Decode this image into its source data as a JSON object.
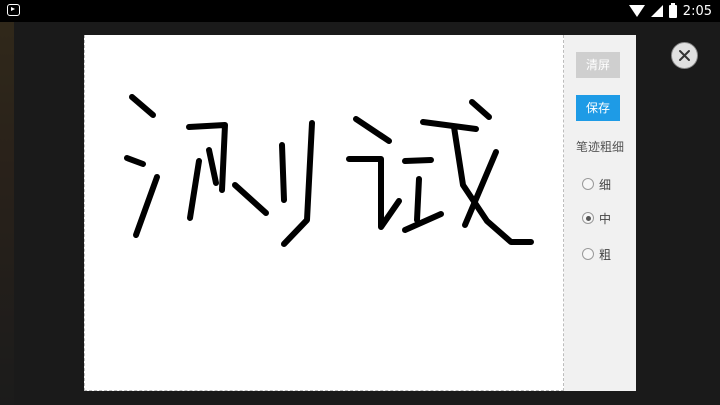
{
  "status_bar": {
    "time": "2:05"
  },
  "dialog": {
    "clear_label": "清屏",
    "save_label": "保存",
    "stroke_width_title": "笔迹粗细",
    "stroke_options": [
      {
        "label": "细",
        "checked": false
      },
      {
        "label": "中",
        "checked": true
      },
      {
        "label": "粗",
        "checked": false
      }
    ],
    "selected_stroke": "中"
  },
  "colors": {
    "accent": "#1e9be6",
    "disabled_button": "#cfcfcf",
    "ink": "#000000"
  },
  "icons": [
    "notification-icon",
    "wifi-icon",
    "signal-icon",
    "battery-icon",
    "close-icon"
  ]
}
